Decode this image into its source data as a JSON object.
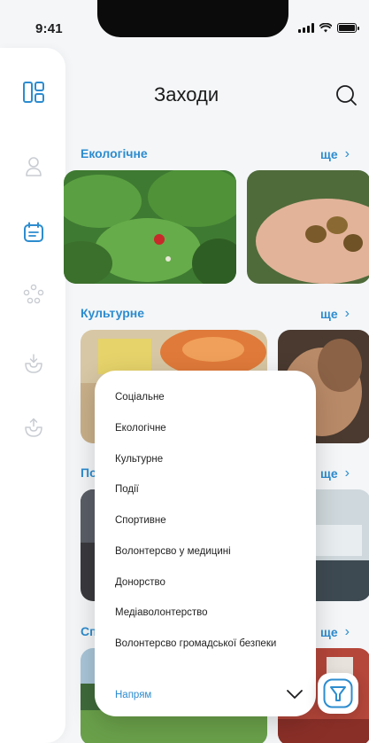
{
  "status_bar": {
    "time": "9:41",
    "battery_level": 1.0
  },
  "header": {
    "title": "Заходи",
    "search_icon": "search-icon"
  },
  "sidebar": {
    "items": [
      {
        "icon": "dashboard-icon",
        "active": false
      },
      {
        "icon": "user-icon",
        "active": false
      },
      {
        "icon": "calendar-icon",
        "active": true
      },
      {
        "icon": "community-icon",
        "active": false
      },
      {
        "icon": "inbox-download-icon",
        "active": false
      },
      {
        "icon": "inbox-upload-icon",
        "active": false
      }
    ],
    "accent_color": "#2d8ccf"
  },
  "sections": [
    {
      "title": "Екологічне",
      "more": "ще"
    },
    {
      "title": "Культурне",
      "more": "ще"
    },
    {
      "title": "По",
      "more": "ще"
    },
    {
      "title": "Сп",
      "more": "ще"
    }
  ],
  "dropdown": {
    "options": [
      "Соціальне",
      "Екологічне",
      "Культурне",
      "Події",
      "Спортивне",
      "Волонтерсво у медицині",
      "Донорство",
      "Медіаволонтерство",
      "Волонтерсво громадської безпеки"
    ],
    "label": "Напрям"
  },
  "colors": {
    "accent": "#2d8ccf",
    "background": "#f4f6f8"
  }
}
